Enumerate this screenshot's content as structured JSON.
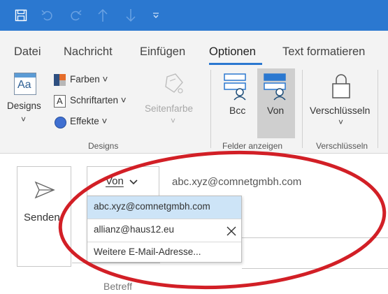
{
  "quick_access": {
    "icons": [
      "save-icon",
      "undo-icon",
      "redo-icon",
      "up-arrow-icon",
      "down-arrow-icon",
      "customize-dropdown-icon"
    ]
  },
  "menu": {
    "tabs": [
      {
        "label": "Datei"
      },
      {
        "label": "Nachricht"
      },
      {
        "label": "Einfügen"
      },
      {
        "label": "Optionen"
      },
      {
        "label": "Text formatieren"
      }
    ],
    "active_tab": "Optionen"
  },
  "ribbon": {
    "designs": {
      "designs_label": "Designs",
      "designs_chevron": "˅",
      "colors_label": "Farben ˅",
      "fonts_label": "Schriftarten ˅",
      "effects_label": "Effekte ˅",
      "group_label": "Designs"
    },
    "page_color": {
      "label": "Seitenfarbe",
      "chevron": "˅"
    },
    "fields": {
      "bcc_label": "Bcc",
      "from_label": "Von",
      "group_label": "Felder anzeigen"
    },
    "encrypt": {
      "label": "Verschlüsseln",
      "chevron": "˅",
      "group_label": "Verschlüsseln"
    }
  },
  "compose": {
    "send_label": "Senden",
    "from_button_label": "Von",
    "from_address": "abc.xyz@comnetgmbh.com",
    "subject_label": "Betreff"
  },
  "from_dropdown": {
    "items": [
      {
        "label": "abc.xyz@comnetgmbh.com",
        "selected": true
      },
      {
        "label": "allianz@haus12.eu",
        "selected": false
      },
      {
        "label": "Weitere E-Mail-Adresse...",
        "selected": false
      }
    ]
  },
  "colors": {
    "titlebar": "#2b78d0",
    "ribbon_bg": "#f3f3f3",
    "dropdown_highlight": "#cde4f7",
    "annotation_ellipse": "#d21f26"
  }
}
